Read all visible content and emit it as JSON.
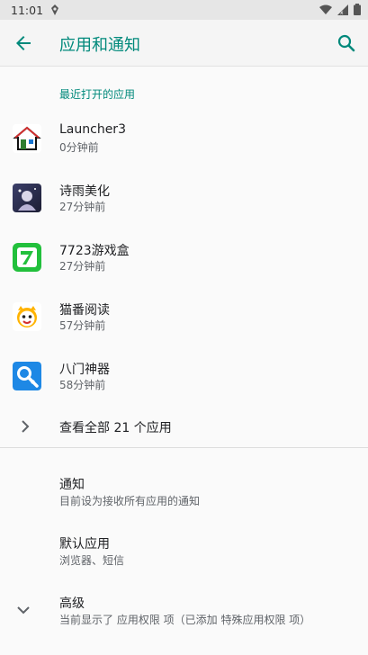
{
  "status_bar": {
    "time": "11:01",
    "icons": [
      "notification-icon",
      "wifi-icon",
      "signal-icon",
      "battery-icon"
    ]
  },
  "app_bar": {
    "title": "应用和通知",
    "back_icon": "arrow-back-icon",
    "search_icon": "search-icon",
    "accent_color": "#00897b",
    "title_color": "#1a73e8"
  },
  "recent": {
    "label": "最近打开的应用",
    "apps": [
      {
        "name": "Launcher3",
        "time": "0分钟前",
        "icon": "house-icon"
      },
      {
        "name": "诗雨美化",
        "time": "27分钟前",
        "icon": "shiyu-icon"
      },
      {
        "name": "7723游戏盒",
        "time": "27分钟前",
        "icon": "game-box-icon"
      },
      {
        "name": "猫番阅读",
        "time": "57分钟前",
        "icon": "cat-reader-icon"
      },
      {
        "name": "八门神器",
        "time": "58分钟前",
        "icon": "key-tool-icon"
      }
    ]
  },
  "see_all": {
    "label": "查看全部 21 个应用"
  },
  "prefs": [
    {
      "title": "通知",
      "summary": "目前设为接收所有应用的通知"
    },
    {
      "title": "默认应用",
      "summary": "浏览器、短信"
    },
    {
      "title": "高级",
      "summary": "当前显示了 应用权限 项（已添加 特殊应用权限 项）"
    }
  ]
}
